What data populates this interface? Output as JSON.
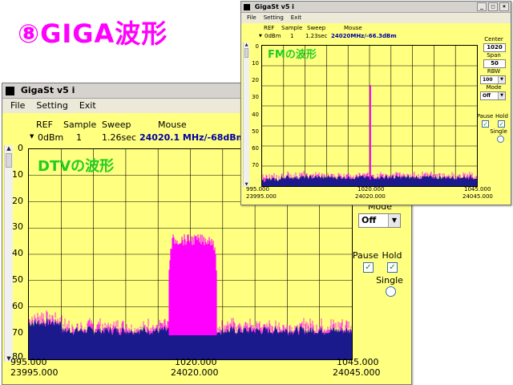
{
  "slide": {
    "title": "⑧GIGA波形"
  },
  "dtv": {
    "window_title": "GigaSt v5 i",
    "menu": [
      "File",
      "Setting",
      "Exit"
    ],
    "header": {
      "ref_label": "REF",
      "ref_value": "0dBm",
      "sample_label": "Sample",
      "sample_value": "1",
      "sweep_label": "Sweep",
      "sweep_value": "1.26sec",
      "mouse_label": "Mouse",
      "mouse_value": "24020.1 MHz/-68dBm"
    },
    "overlay_label": "DTVの波形",
    "y_ticks": [
      "0",
      "10",
      "20",
      "30",
      "40",
      "50",
      "60",
      "70",
      "80"
    ],
    "x_top": [
      "995.000",
      "1020.000",
      "1045.000"
    ],
    "x_bottom": [
      "23995.000",
      "24020.000",
      "24045.000"
    ],
    "panel": {
      "mode_label": "Mode",
      "mode_value": "Off",
      "pause_label": "Pause",
      "pause_checked": true,
      "hold_label": "Hold",
      "hold_checked": true,
      "single_label": "Single"
    },
    "colors": {
      "plot_bg": "#ffff80",
      "noise": "#1a1a8c",
      "signal": "#ff00ff"
    }
  },
  "fm": {
    "window_title": "GigaSt v5 i",
    "menu": [
      "File",
      "Setting",
      "Exit"
    ],
    "header": {
      "ref_label": "REF",
      "ref_value": "0dBm",
      "sample_label": "Sample",
      "sample_value": "1",
      "sweep_label": "Sweep",
      "sweep_value": "1.23sec",
      "mouse_label": "Mouse",
      "mouse_value": "24020MHz/-66.3dBm"
    },
    "overlay_label": "FMの波形",
    "y_ticks": [
      "0",
      "10",
      "20",
      "30",
      "40",
      "50",
      "60",
      "70"
    ],
    "x_top": [
      "995.000",
      "1020.000",
      "1045.000"
    ],
    "x_bottom": [
      "23995.000",
      "24020.000",
      "24045.000"
    ],
    "panel": {
      "center_label": "Center",
      "center_value": "1020",
      "span_label": "Span",
      "span_value": "50",
      "rbw_label": "RBW",
      "rbw_value": "100",
      "mode_label": "Mode",
      "mode_value": "Off",
      "pause_label": "Pause",
      "pause_checked": true,
      "hold_label": "Hold",
      "hold_checked": true,
      "single_label": "Single"
    },
    "colors": {
      "plot_bg": "#ffff80",
      "noise": "#1a1a8c",
      "signal": "#ff00ff"
    }
  }
}
